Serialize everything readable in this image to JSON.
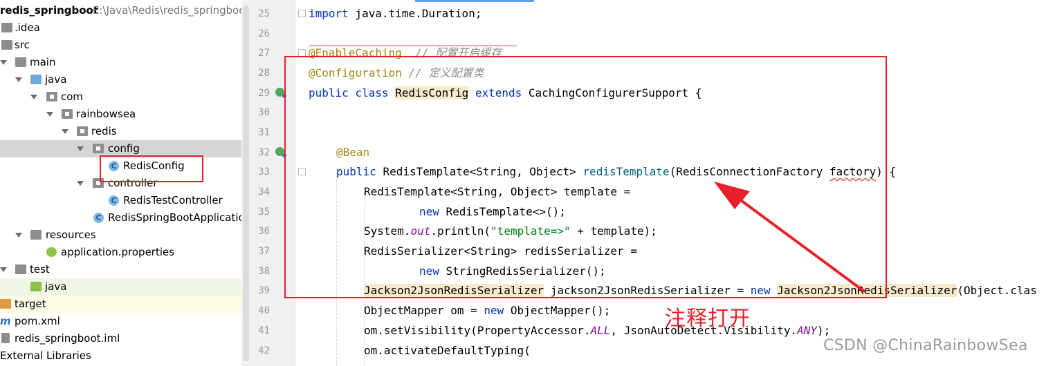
{
  "project_tree": {
    "root_name": "redis_springboot",
    "root_path": "E:\\Java\\Redis\\redis_springboot",
    "items": [
      {
        "label": ".idea"
      },
      {
        "label": "src"
      },
      {
        "label": "main"
      },
      {
        "label": "java"
      },
      {
        "label": "com"
      },
      {
        "label": "rainbowsea"
      },
      {
        "label": "redis"
      },
      {
        "label": "config"
      },
      {
        "label": "RedisConfig"
      },
      {
        "label": "controller"
      },
      {
        "label": "RedisTestController"
      },
      {
        "label": "RedisSpringBootApplication"
      },
      {
        "label": "resources"
      },
      {
        "label": "application.properties"
      },
      {
        "label": "test"
      },
      {
        "label": "java"
      },
      {
        "label": "target"
      },
      {
        "label": "pom.xml"
      },
      {
        "label": "redis_springboot.iml"
      },
      {
        "label": "External Libraries"
      }
    ],
    "class_icon_letter": "C"
  },
  "editor": {
    "line_numbers": [
      "25",
      "26",
      "27",
      "28",
      "29",
      "30",
      "31",
      "32",
      "33",
      "34",
      "35",
      "36",
      "37",
      "38",
      "39",
      "40",
      "41",
      "42"
    ],
    "code": {
      "l25": {
        "kw": "import",
        "rest": " java.time.Duration;"
      },
      "l27": {
        "ann": "@EnableCaching",
        "cmt": "  // 配置开启缓存"
      },
      "l28": {
        "ann": "@Configuration",
        "cmt": " // 定义配置类"
      },
      "l29": {
        "kw1": "public class ",
        "cls": "RedisConfig",
        "kw2": " extends ",
        "rest": "CachingConfigurerSupport {"
      },
      "l32": {
        "ann": "@Bean"
      },
      "l33": {
        "kw": "public ",
        "type": "RedisTemplate<String, Object> ",
        "fn": "redisTemplate",
        "p1": "(RedisConnectionFactory ",
        "param": "factory",
        "p2": ") {"
      },
      "l34": {
        "text": "RedisTemplate<String, Object> template ="
      },
      "l35": {
        "kw": "new ",
        "rest": "RedisTemplate<>();"
      },
      "l36": {
        "a": "System.",
        "fld": "out",
        "b": ".println(",
        "str": "\"template=>\"",
        "c": " + template);"
      },
      "l37": {
        "text": "RedisSerializer<String> redisSerializer ="
      },
      "l38": {
        "kw": "new ",
        "rest": "StringRedisSerializer();"
      },
      "l39": {
        "hl1": "Jackson2JsonRedisSerializer",
        "a": " jackson2JsonRedisSerializer = ",
        "kw": "new ",
        "hl2": "Jackson2JsonRedisSerializer",
        "b": "(Object.clas"
      },
      "l40": {
        "a": "ObjectMapper om = ",
        "kw": "new ",
        "b": "ObjectMapper();"
      },
      "l41": {
        "a": "om.setVisibility(PropertyAccessor.",
        "f1": "ALL",
        "b": ", JsonAutoDetect.Visibility.",
        "f2": "ANY",
        "c": ");"
      },
      "l42": {
        "text": "om.activateDefaultTyping("
      }
    }
  },
  "annotation": {
    "label": "注释打开",
    "color": "#e8202a"
  },
  "watermark": "CSDN @ChinaRainbowSea"
}
